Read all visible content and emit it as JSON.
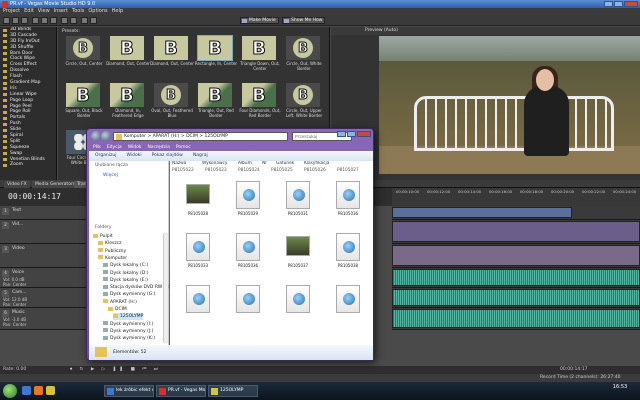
{
  "vegas": {
    "title": "PR.vf - Vegas Movie Studio HD 9.0",
    "menu": [
      "Project",
      "Edit",
      "View",
      "Insert",
      "Tools",
      "Options",
      "Help"
    ],
    "toolbar": {
      "make_movie": "Make Movie",
      "show_me_how": "Show Me How"
    },
    "transitions": [
      "3D Blinds",
      "3D Cascade",
      "3D Fly In/Out",
      "3D Shuffle",
      "Barn Door",
      "Clock Wipe",
      "Cross Effect",
      "Dissolve",
      "Flash",
      "Gradient Map",
      "Iris",
      "Linear Wipe",
      "Page Loop",
      "Page Peel",
      "Page Roll",
      "Portals",
      "Push",
      "Slide",
      "Spiral",
      "Split",
      "Squeeze",
      "Swap",
      "Venetian Blinds",
      "Zoom"
    ],
    "presets_label": "Presets:",
    "presets": [
      {
        "cap": "Circle, Out, Center",
        "type": "circle"
      },
      {
        "cap": "Diamond, Out, Center",
        "type": "plain"
      },
      {
        "cap": "Diamond, Out, Center",
        "type": "plain"
      },
      {
        "cap": "Rectangle, In, Center",
        "type": "plain"
      },
      {
        "cap": "Triangle Down, Out, Center",
        "type": "plain"
      },
      {
        "cap": "Circle, Out, White Border",
        "type": "circle"
      },
      {
        "cap": "Square, Out, Black Border",
        "type": "grad"
      },
      {
        "cap": "Diamond, In, Feathered Edge",
        "type": "grad"
      },
      {
        "cap": "Oval, Out, Feathered Blue",
        "type": "circle"
      },
      {
        "cap": "Triangle, Out, Red Border",
        "type": "grad"
      },
      {
        "cap": "Four Diamonds, Out, Red Border",
        "type": "grad"
      },
      {
        "cap": "Circle, Out, Upper Left, White Border",
        "type": "circle"
      },
      {
        "cap": "Four Circles, Out, White Border",
        "type": "dots"
      }
    ],
    "preview_label": "Preview (Auto)",
    "tabs": [
      "Video FX",
      "Media Generators",
      "Transitions"
    ],
    "timecode": "00:00:14:17",
    "ruler_ticks": [
      "00:00:10:00",
      "00:00:12:00",
      "00:00:14:00",
      "00:00:16:00",
      "00:00:18:00",
      "00:00:20:00",
      "00:00:22:00",
      "00:00:24:00"
    ],
    "tracks": [
      {
        "num": "1",
        "name": "Text"
      },
      {
        "num": "2",
        "name": "Vid..."
      },
      {
        "num": "3",
        "name": "Video"
      },
      {
        "num": "4",
        "name": "Voice",
        "vol": "Vol: 0.0 dB",
        "pan": "Pan: Center"
      },
      {
        "num": "5",
        "name": "Cam...",
        "vol": "Vol: 12.0 dB",
        "pan": "Pan: Center"
      },
      {
        "num": "6",
        "name": "Music",
        "vol": "Vol: -3.0 dB",
        "pan": "Pan: Center"
      }
    ],
    "rate": "Rate: 0.00",
    "playbar_time": "00:00:14:17",
    "record_time": "Record Time (2 channels): 26:27:40"
  },
  "explorer": {
    "address": "Komputer > APARAT (H:) > DCIM > 125OLYMP",
    "search_placeholder": "Przeszukaj",
    "menu": [
      "Plik",
      "Edycja",
      "Widok",
      "Narzędzia",
      "Pomoc"
    ],
    "commands": [
      "Organizuj",
      "Widoki",
      "Pokaz slajdów",
      "Nagraj"
    ],
    "favorites_header": "Ulubione łącza",
    "more_link": "Więcej",
    "folders_header": "Foldery",
    "tree": [
      {
        "label": "Pulpit",
        "indent": 0
      },
      {
        "label": "Kleszcz",
        "indent": 1
      },
      {
        "label": "Publiczny",
        "indent": 1
      },
      {
        "label": "Komputer",
        "indent": 1
      },
      {
        "label": "Dysk lokalny (C:)",
        "indent": 2
      },
      {
        "label": "Dysk lokalny (D:)",
        "indent": 2
      },
      {
        "label": "Dysk lokalny (E:)",
        "indent": 2
      },
      {
        "label": "Stacja dysków DVD RW (F:)",
        "indent": 2
      },
      {
        "label": "Dysk wymienny (G:)",
        "indent": 2
      },
      {
        "label": "APARAT (H:)",
        "indent": 2
      },
      {
        "label": "DCIM",
        "indent": 3
      },
      {
        "label": "125OLYMP",
        "indent": 4
      },
      {
        "label": "Dysk wymienny (I:)",
        "indent": 2
      },
      {
        "label": "Dysk wymienny (J:)",
        "indent": 2
      },
      {
        "label": "Dysk wymienny (K:)",
        "indent": 2
      }
    ],
    "columns": [
      "Nazwa",
      "Wykonawcy",
      "Album",
      "Nr",
      "Gatunek",
      "Klasyfikacja"
    ],
    "col_sub": [
      "P8105022",
      "P8105023",
      "P8105024",
      "P8105025",
      "P8105026",
      "P8105027"
    ],
    "files": [
      {
        "name": "P8105028",
        "kind": "photo"
      },
      {
        "name": "P8105029",
        "kind": "media"
      },
      {
        "name": "P8105031",
        "kind": "media"
      },
      {
        "name": "P8105036",
        "kind": "media"
      },
      {
        "name": "P8105033",
        "kind": "media"
      },
      {
        "name": "P8105036",
        "kind": "media"
      },
      {
        "name": "P8105037",
        "kind": "photo"
      },
      {
        "name": "P8105038",
        "kind": "media"
      }
    ],
    "status": "Elementów: 52"
  },
  "taskbar": {
    "tasks": [
      "lek żróbic efekt co2...",
      "PR.vf - Vegas Movie...",
      "125OLYMP"
    ],
    "clock": "16:53"
  }
}
